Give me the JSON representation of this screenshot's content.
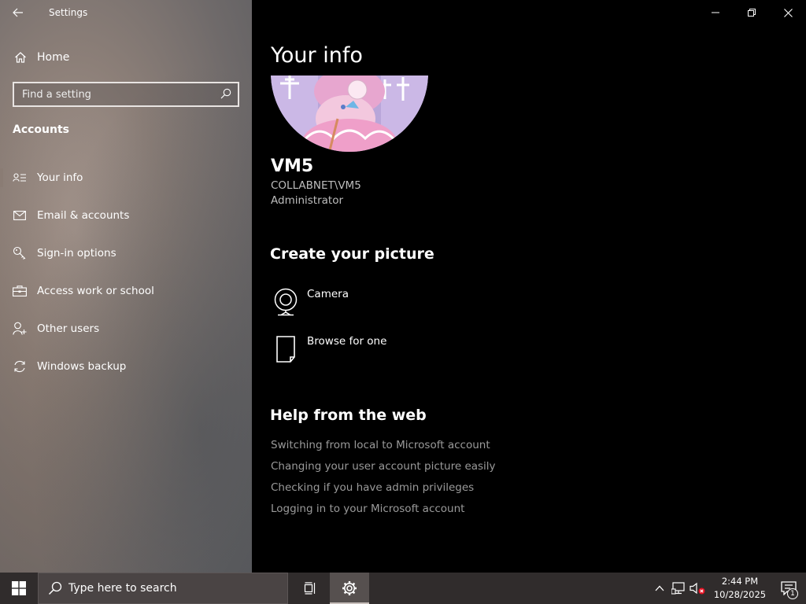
{
  "window": {
    "title": "Settings"
  },
  "sidebar": {
    "home_label": "Home",
    "search_placeholder": "Find a setting",
    "section_heading": "Accounts",
    "items": [
      {
        "label": "Your info",
        "icon": "person-card-icon",
        "selected": true
      },
      {
        "label": "Email & accounts",
        "icon": "mail-icon",
        "selected": false
      },
      {
        "label": "Sign-in options",
        "icon": "key-icon",
        "selected": false
      },
      {
        "label": "Access work or school",
        "icon": "briefcase-icon",
        "selected": false
      },
      {
        "label": "Other users",
        "icon": "person-add-icon",
        "selected": false
      },
      {
        "label": "Windows backup",
        "icon": "sync-icon",
        "selected": false
      }
    ]
  },
  "main": {
    "page_title": "Your info",
    "user": {
      "name": "VM5",
      "account": "COLLABNET\\VM5",
      "role": "Administrator"
    },
    "create_picture": {
      "heading": "Create your picture",
      "options": [
        {
          "label": "Camera",
          "icon": "camera-icon"
        },
        {
          "label": "Browse for one",
          "icon": "file-icon"
        }
      ]
    },
    "help": {
      "heading": "Help from the web",
      "links": [
        "Switching from local to Microsoft account",
        "Changing your user account picture easily",
        "Checking if you have admin privileges",
        "Logging in to your Microsoft account"
      ]
    }
  },
  "taskbar": {
    "search_placeholder": "Type here to search",
    "time": "2:44 PM",
    "date": "10/28/2025",
    "notification_count": "1"
  },
  "colors": {
    "selected_indicator": "#8a7c74",
    "help_link": "#9a9a9a",
    "taskbar_bg": "#302c2c"
  }
}
